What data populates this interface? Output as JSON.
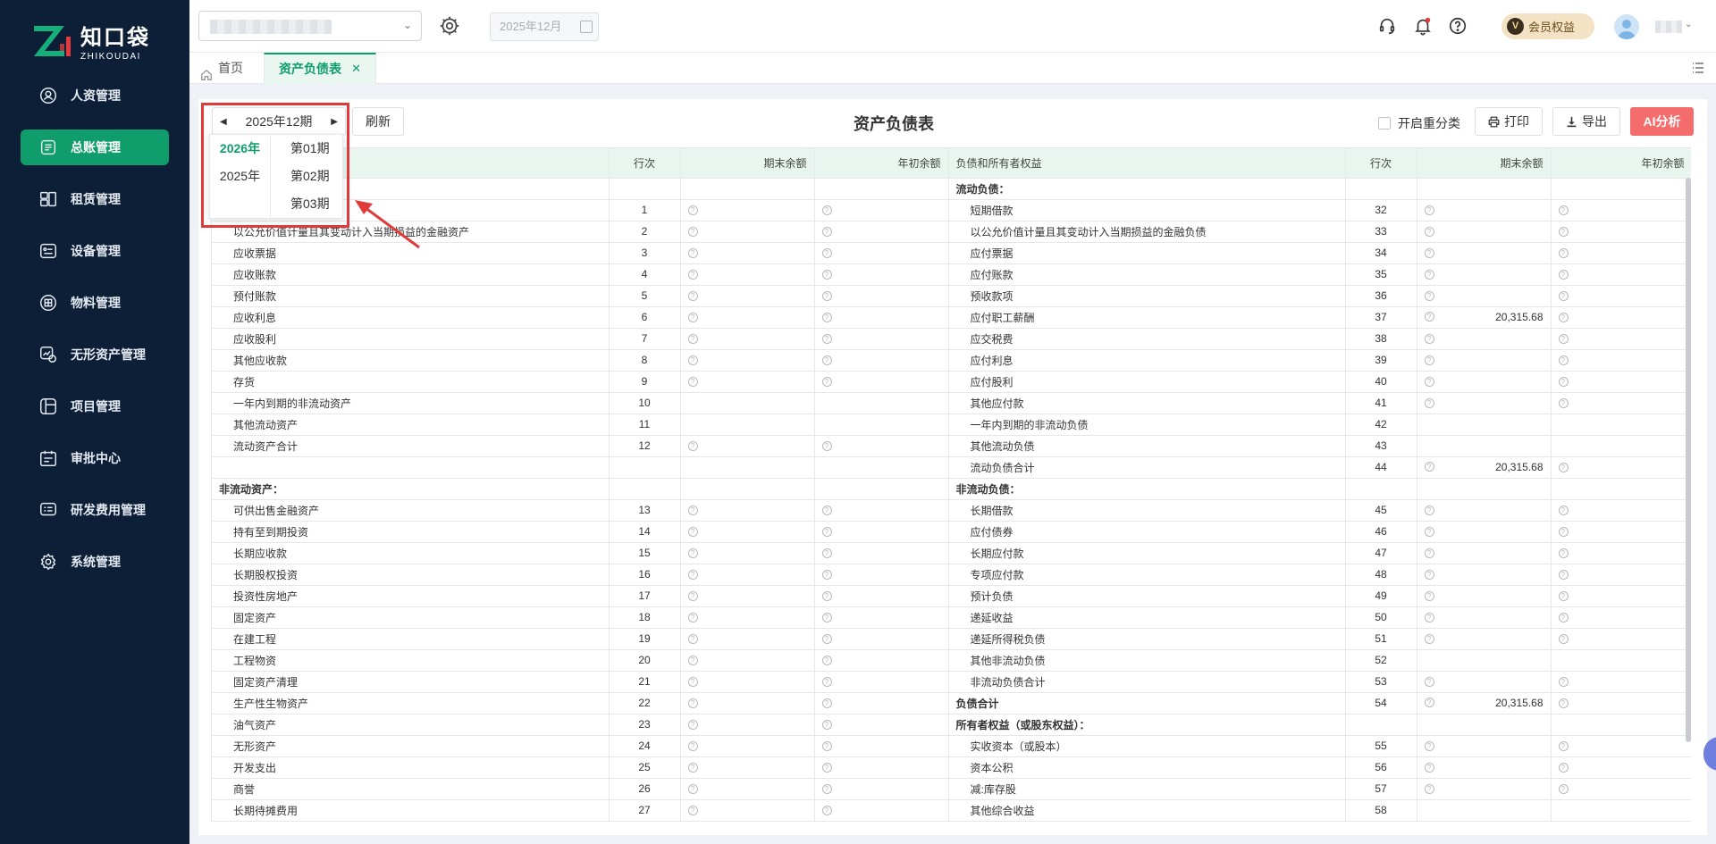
{
  "brand": {
    "name_cn": "知口袋",
    "name_en": "ZHIKOUDAI"
  },
  "sidebar": {
    "items": [
      {
        "label": "人资管理",
        "icon": "person-badge-icon",
        "active": false
      },
      {
        "label": "总账管理",
        "icon": "ledger-icon",
        "active": true
      },
      {
        "label": "租赁管理",
        "icon": "lease-icon",
        "active": false
      },
      {
        "label": "设备管理",
        "icon": "device-icon",
        "active": false
      },
      {
        "label": "物料管理",
        "icon": "material-box-icon",
        "active": false
      },
      {
        "label": "无形资产管理",
        "icon": "intangible-asset-icon",
        "active": false
      },
      {
        "label": "项目管理",
        "icon": "project-icon",
        "active": false
      },
      {
        "label": "审批中心",
        "icon": "approval-calendar-icon",
        "active": false
      },
      {
        "label": "研发费用管理",
        "icon": "rd-expense-icon",
        "active": false
      },
      {
        "label": "系统管理",
        "icon": "system-gear-icon",
        "active": false
      }
    ]
  },
  "header": {
    "date_value": "2025年12月",
    "vip_label": "会员权益",
    "vip_badge": "V"
  },
  "tabs": {
    "home": "首页",
    "active": "资产负债表",
    "close": "✕"
  },
  "toolbar": {
    "period": "2025年12期",
    "refresh": "刷新",
    "title": "资产负债表",
    "reclass_label": "开启重分类",
    "print": "打印",
    "export": "导出",
    "ai": "AI分析"
  },
  "period_dropdown": {
    "years": [
      "2026年",
      "2025年"
    ],
    "selected_year": "2026年",
    "periods": [
      "第01期",
      "第02期",
      "第03期"
    ]
  },
  "table": {
    "headers": [
      "",
      "行次",
      "期末余额",
      "年初余额",
      "负债和所有者权益",
      "行次",
      "期末余额",
      "年初余额"
    ],
    "rows": [
      {
        "l": {
          "name": "",
          "line": "",
          "end": "",
          "begin": "",
          "style": ""
        },
        "r": {
          "name": "流动负债：",
          "line": "",
          "end": "",
          "begin": "",
          "style": "bold"
        }
      },
      {
        "l": {
          "name": "",
          "line": "1",
          "end": "q",
          "begin": "q",
          "style": "indent"
        },
        "r": {
          "name": "短期借款",
          "line": "32",
          "end": "q",
          "begin": "q",
          "style": "indent"
        }
      },
      {
        "l": {
          "name": "以公允价值计量且其变动计入当期损益的金融资产",
          "line": "2",
          "end": "q",
          "begin": "q",
          "style": "indent"
        },
        "r": {
          "name": "以公允价值计量且其变动计入当期损益的金融负债",
          "line": "33",
          "end": "q",
          "begin": "q",
          "style": "indent"
        }
      },
      {
        "l": {
          "name": "应收票据",
          "line": "3",
          "end": "q",
          "begin": "q",
          "style": "indent"
        },
        "r": {
          "name": "应付票据",
          "line": "34",
          "end": "q",
          "begin": "q",
          "style": "indent"
        }
      },
      {
        "l": {
          "name": "应收账款",
          "line": "4",
          "end": "q",
          "begin": "q",
          "style": "indent"
        },
        "r": {
          "name": "应付账款",
          "line": "35",
          "end": "q",
          "begin": "q",
          "style": "indent"
        }
      },
      {
        "l": {
          "name": "预付账款",
          "line": "5",
          "end": "q",
          "begin": "q",
          "style": "indent"
        },
        "r": {
          "name": "预收款项",
          "line": "36",
          "end": "q",
          "begin": "q",
          "style": "indent"
        }
      },
      {
        "l": {
          "name": "应收利息",
          "line": "6",
          "end": "q",
          "begin": "q",
          "style": "indent"
        },
        "r": {
          "name": "应付职工薪酬",
          "line": "37",
          "end": "q:20,315.68",
          "begin": "q",
          "style": "indent"
        }
      },
      {
        "l": {
          "name": "应收股利",
          "line": "7",
          "end": "q",
          "begin": "q",
          "style": "indent"
        },
        "r": {
          "name": "应交税费",
          "line": "38",
          "end": "q",
          "begin": "q",
          "style": "indent"
        }
      },
      {
        "l": {
          "name": "其他应收款",
          "line": "8",
          "end": "q",
          "begin": "q",
          "style": "indent"
        },
        "r": {
          "name": "应付利息",
          "line": "39",
          "end": "q",
          "begin": "q",
          "style": "indent"
        }
      },
      {
        "l": {
          "name": "存货",
          "line": "9",
          "end": "q",
          "begin": "q",
          "style": "indent"
        },
        "r": {
          "name": "应付股利",
          "line": "40",
          "end": "q",
          "begin": "q",
          "style": "indent"
        }
      },
      {
        "l": {
          "name": "一年内到期的非流动资产",
          "line": "10",
          "end": "",
          "begin": "",
          "style": "indent"
        },
        "r": {
          "name": "其他应付款",
          "line": "41",
          "end": "q",
          "begin": "q",
          "style": "indent"
        }
      },
      {
        "l": {
          "name": "其他流动资产",
          "line": "11",
          "end": "",
          "begin": "",
          "style": "indent"
        },
        "r": {
          "name": "一年内到期的非流动负债",
          "line": "42",
          "end": "",
          "begin": "",
          "style": "indent"
        }
      },
      {
        "l": {
          "name": "流动资产合计",
          "line": "12",
          "end": "q",
          "begin": "q",
          "style": "indent"
        },
        "r": {
          "name": "其他流动负债",
          "line": "43",
          "end": "",
          "begin": "",
          "style": "indent"
        }
      },
      {
        "l": {
          "name": "",
          "line": "",
          "end": "",
          "begin": "",
          "style": ""
        },
        "r": {
          "name": "流动负债合计",
          "line": "44",
          "end": "q:20,315.68",
          "begin": "q",
          "style": "indent"
        }
      },
      {
        "l": {
          "name": "非流动资产：",
          "line": "",
          "end": "",
          "begin": "",
          "style": "bold"
        },
        "r": {
          "name": "非流动负债：",
          "line": "",
          "end": "",
          "begin": "",
          "style": "bold"
        }
      },
      {
        "l": {
          "name": "可供出售金融资产",
          "line": "13",
          "end": "q",
          "begin": "q",
          "style": "indent"
        },
        "r": {
          "name": "长期借款",
          "line": "45",
          "end": "q",
          "begin": "q",
          "style": "indent"
        }
      },
      {
        "l": {
          "name": "持有至到期投资",
          "line": "14",
          "end": "q",
          "begin": "q",
          "style": "indent"
        },
        "r": {
          "name": "应付债券",
          "line": "46",
          "end": "q",
          "begin": "q",
          "style": "indent"
        }
      },
      {
        "l": {
          "name": "长期应收款",
          "line": "15",
          "end": "q",
          "begin": "q",
          "style": "indent"
        },
        "r": {
          "name": "长期应付款",
          "line": "47",
          "end": "q",
          "begin": "q",
          "style": "indent"
        }
      },
      {
        "l": {
          "name": "长期股权投资",
          "line": "16",
          "end": "q",
          "begin": "q",
          "style": "indent"
        },
        "r": {
          "name": "专项应付款",
          "line": "48",
          "end": "q",
          "begin": "q",
          "style": "indent"
        }
      },
      {
        "l": {
          "name": "投资性房地产",
          "line": "17",
          "end": "q",
          "begin": "q",
          "style": "indent"
        },
        "r": {
          "name": "预计负债",
          "line": "49",
          "end": "q",
          "begin": "q",
          "style": "indent"
        }
      },
      {
        "l": {
          "name": "固定资产",
          "line": "18",
          "end": "q",
          "begin": "q",
          "style": "indent"
        },
        "r": {
          "name": "递延收益",
          "line": "50",
          "end": "q",
          "begin": "q",
          "style": "indent"
        }
      },
      {
        "l": {
          "name": "在建工程",
          "line": "19",
          "end": "q",
          "begin": "q",
          "style": "indent"
        },
        "r": {
          "name": "递延所得税负债",
          "line": "51",
          "end": "q",
          "begin": "q",
          "style": "indent"
        }
      },
      {
        "l": {
          "name": "工程物资",
          "line": "20",
          "end": "q",
          "begin": "q",
          "style": "indent"
        },
        "r": {
          "name": "其他非流动负债",
          "line": "52",
          "end": "",
          "begin": "",
          "style": "indent"
        }
      },
      {
        "l": {
          "name": "固定资产清理",
          "line": "21",
          "end": "q",
          "begin": "q",
          "style": "indent"
        },
        "r": {
          "name": "非流动负债合计",
          "line": "53",
          "end": "q",
          "begin": "q",
          "style": "indent"
        }
      },
      {
        "l": {
          "name": "生产性生物资产",
          "line": "22",
          "end": "q",
          "begin": "q",
          "style": "indent"
        },
        "r": {
          "name": "负债合计",
          "line": "54",
          "end": "q:20,315.68",
          "begin": "q",
          "style": "bold"
        }
      },
      {
        "l": {
          "name": "油气资产",
          "line": "23",
          "end": "q",
          "begin": "q",
          "style": "indent"
        },
        "r": {
          "name": "所有者权益（或股东权益）：",
          "line": "",
          "end": "",
          "begin": "",
          "style": "bold"
        }
      },
      {
        "l": {
          "name": "无形资产",
          "line": "24",
          "end": "q",
          "begin": "q",
          "style": "indent"
        },
        "r": {
          "name": "实收资本（或股本）",
          "line": "55",
          "end": "q",
          "begin": "q",
          "style": "indent"
        }
      },
      {
        "l": {
          "name": "开发支出",
          "line": "25",
          "end": "q",
          "begin": "q",
          "style": "indent"
        },
        "r": {
          "name": "资本公积",
          "line": "56",
          "end": "q",
          "begin": "q",
          "style": "indent"
        }
      },
      {
        "l": {
          "name": "商誉",
          "line": "26",
          "end": "q",
          "begin": "q",
          "style": "indent"
        },
        "r": {
          "name": "减:库存股",
          "line": "57",
          "end": "q",
          "begin": "q",
          "style": "indent"
        }
      },
      {
        "l": {
          "name": "长期待摊费用",
          "line": "27",
          "end": "q",
          "begin": "q",
          "style": "indent"
        },
        "r": {
          "name": "其他综合收益",
          "line": "58",
          "end": "",
          "begin": "",
          "style": "indent"
        }
      }
    ]
  },
  "colors": {
    "brand_green": "#0f9d6b",
    "sidebar_bg": "#0c1f36",
    "ai_red": "#f56c6c",
    "annotation_red": "#e03a3a"
  }
}
